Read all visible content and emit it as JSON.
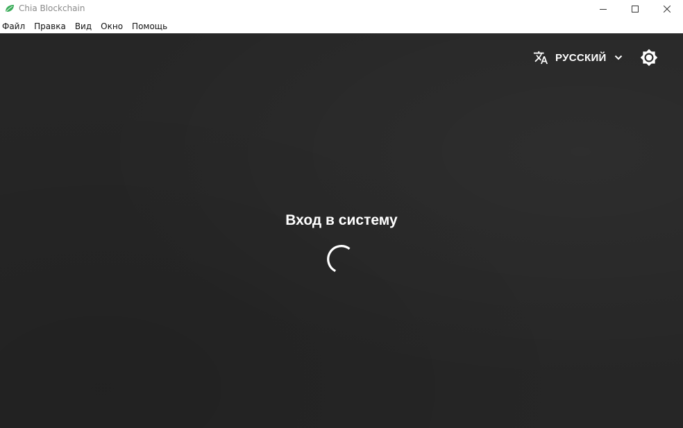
{
  "window": {
    "title": "Chia Blockchain",
    "accent_color": "#3aac59"
  },
  "menu": {
    "items": [
      {
        "label": "Файл"
      },
      {
        "label": "Правка"
      },
      {
        "label": "Вид"
      },
      {
        "label": "Окно"
      },
      {
        "label": "Помощь"
      }
    ]
  },
  "header": {
    "language_label": "РУССКИЙ",
    "translate_icon": "translate-icon",
    "theme_icon": "brightness-icon"
  },
  "main": {
    "heading": "Вход в систему",
    "background_color": "#262626",
    "status": "loading"
  }
}
